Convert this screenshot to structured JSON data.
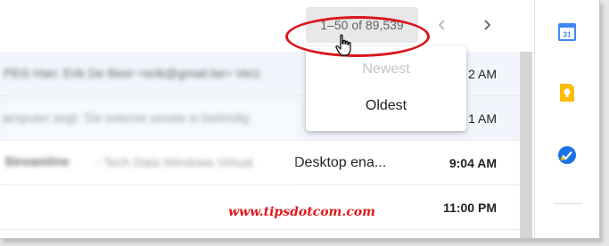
{
  "toolbar": {
    "pagination_label": "1–50 of 89,539",
    "prev_icon": "chevron-left-icon",
    "next_icon": "chevron-right-icon"
  },
  "sort_menu": {
    "items": [
      {
        "label": "Newest",
        "state": "disabled"
      },
      {
        "label": "Oldest",
        "state": "enabled"
      }
    ]
  },
  "email_list": {
    "rows": [
      {
        "preview_blurred": "PEG Han: Erik De Beer <erik@gmail.be> Verz",
        "time": "2 AM",
        "bold": false
      },
      {
        "preview_blurred": "omputer zegt: 'De externe sessie is beëindig",
        "time": "1 AM",
        "bold": false
      },
      {
        "sender_blurred": "Streamline",
        "preview_blurred": "- Tech Data Windows Virtual",
        "subject_tail": "Desktop ena...",
        "time": "9:04 AM",
        "bold": true
      },
      {
        "time": "11:00 PM",
        "bold": true
      }
    ]
  },
  "watermark": "www.tipsdotcom.com",
  "side_panel": {
    "icons": [
      "calendar-icon",
      "keep-icon",
      "tasks-icon"
    ],
    "calendar_day": "31"
  },
  "colors": {
    "highlight": "#d9151c",
    "calendar_blue": "#4285f4",
    "keep_yellow": "#fbbc04",
    "tasks_blue": "#1a73e8",
    "watermark_red": "#e0181c"
  }
}
